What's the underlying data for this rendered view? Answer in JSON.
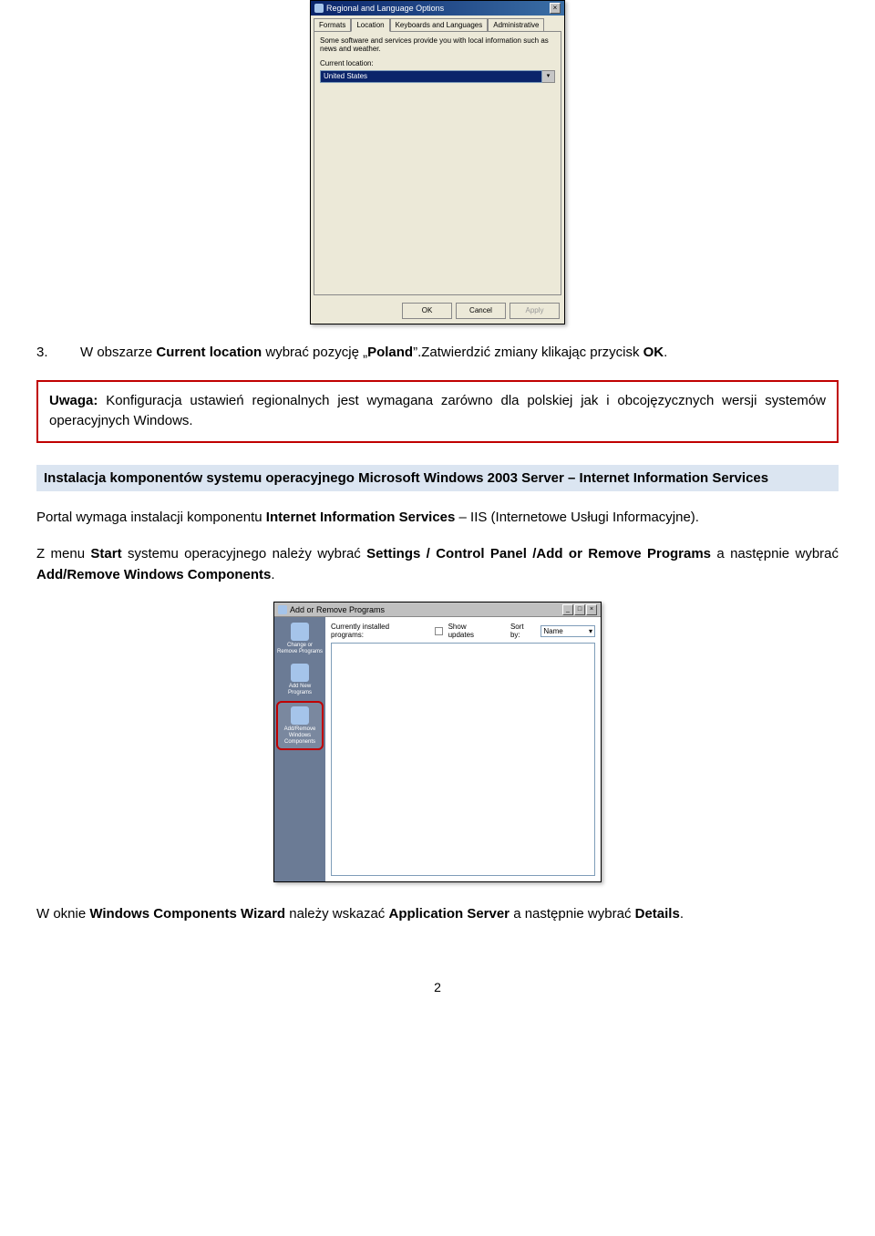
{
  "screenshot1": {
    "title": "Regional and Language Options",
    "tabs": [
      "Formats",
      "Location",
      "Keyboards and Languages",
      "Administrative"
    ],
    "info_text": "Some software and services provide you with local information such as news and weather.",
    "current_location_label": "Current location:",
    "selected_location": "United States",
    "buttons": {
      "ok": "OK",
      "cancel": "Cancel",
      "apply": "Apply"
    }
  },
  "step3": {
    "num": "3.",
    "pre": "W obszarze ",
    "b1": "Current location",
    "mid": " wybrać pozycję „",
    "b2": "Poland",
    "zat": "”.Zatwierdzić zmiany klikając przycisk ",
    "b3": "OK",
    "end": "."
  },
  "uwaga": {
    "b1": "Uwaga:",
    "text": " Konfiguracja ustawień regionalnych jest wymagana zarówno dla polskiej jak i obcojęzycznych wersji systemów operacyjnych Windows."
  },
  "section_heading": "Instalacja komponentów systemu operacyjnego Microsoft Windows 2003 Server – Internet Information Services",
  "para1": {
    "p0": "Portal wymaga instalacji komponentu ",
    "b1": "Internet Information Services",
    "p1": " – IIS (Internetowe Usługi Informacyjne)."
  },
  "para2": {
    "p0": "Z menu ",
    "b1": "Start",
    "p1": " systemu operacyjnego należy wybrać ",
    "b2": "Settings / Control Panel /Add or Remove Programs",
    "p2": " a następnie wybrać ",
    "b3": "Add/Remove Windows Components",
    "p3": "."
  },
  "screenshot2": {
    "title": "Add or Remove Programs",
    "sidebar": [
      {
        "label": "Change or Remove Programs"
      },
      {
        "label": "Add New Programs"
      },
      {
        "label": "Add/Remove Windows Components"
      }
    ],
    "currently_installed": "Currently installed programs:",
    "show_updates": "Show updates",
    "sort_by": "Sort by:",
    "sort_value": "Name"
  },
  "para3": {
    "p0": "W oknie ",
    "b1": "Windows Components Wizard",
    "p1": " należy wskazać ",
    "b2": "Application Server",
    "p2": " a następnie wybrać ",
    "b3": "Details",
    "p3": "."
  },
  "page_number": "2"
}
